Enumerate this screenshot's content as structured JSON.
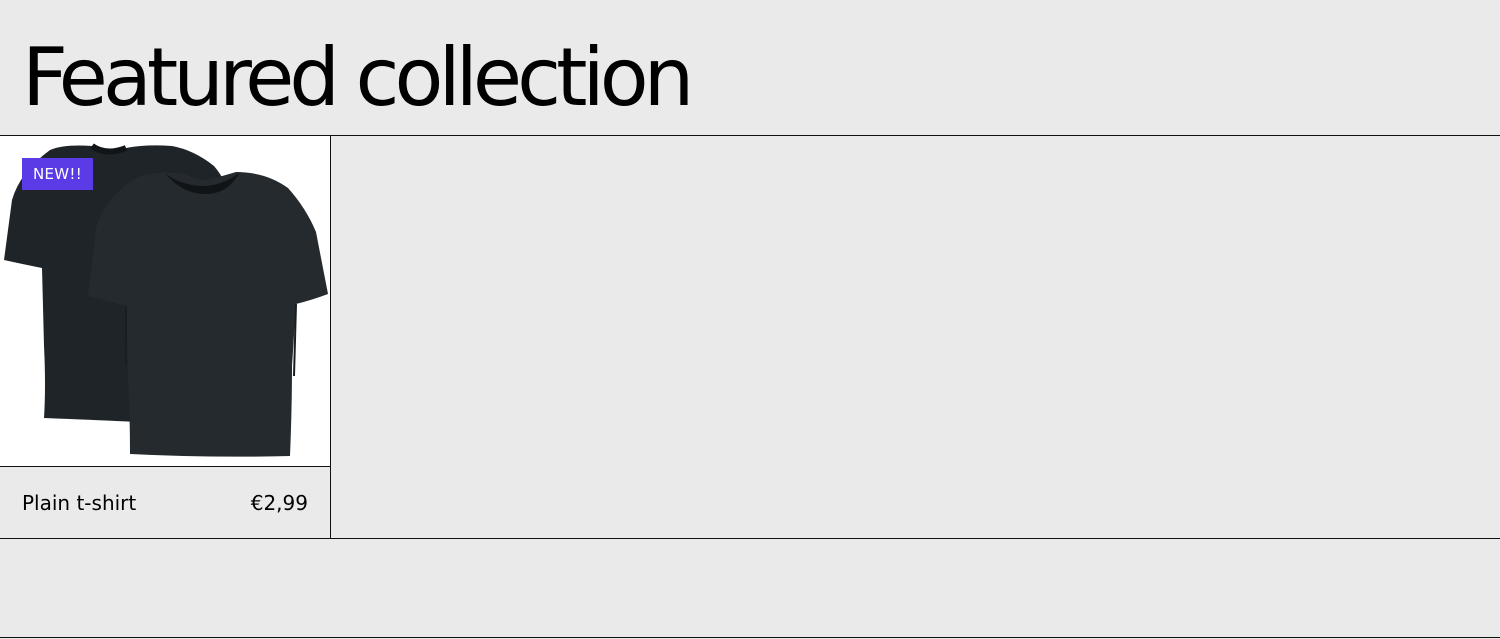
{
  "section": {
    "title": "Featured collection"
  },
  "products": [
    {
      "name": "Plain t-shirt",
      "price": "€2,99",
      "badge": "NEW!!",
      "image_icon": "t-shirt-icon"
    }
  ],
  "colors": {
    "page_background": "#eaeaea",
    "badge_background": "#5a3be6",
    "badge_text": "#ffffff",
    "divider": "#111111",
    "image_background": "#ffffff",
    "shirt": "#22272b"
  }
}
